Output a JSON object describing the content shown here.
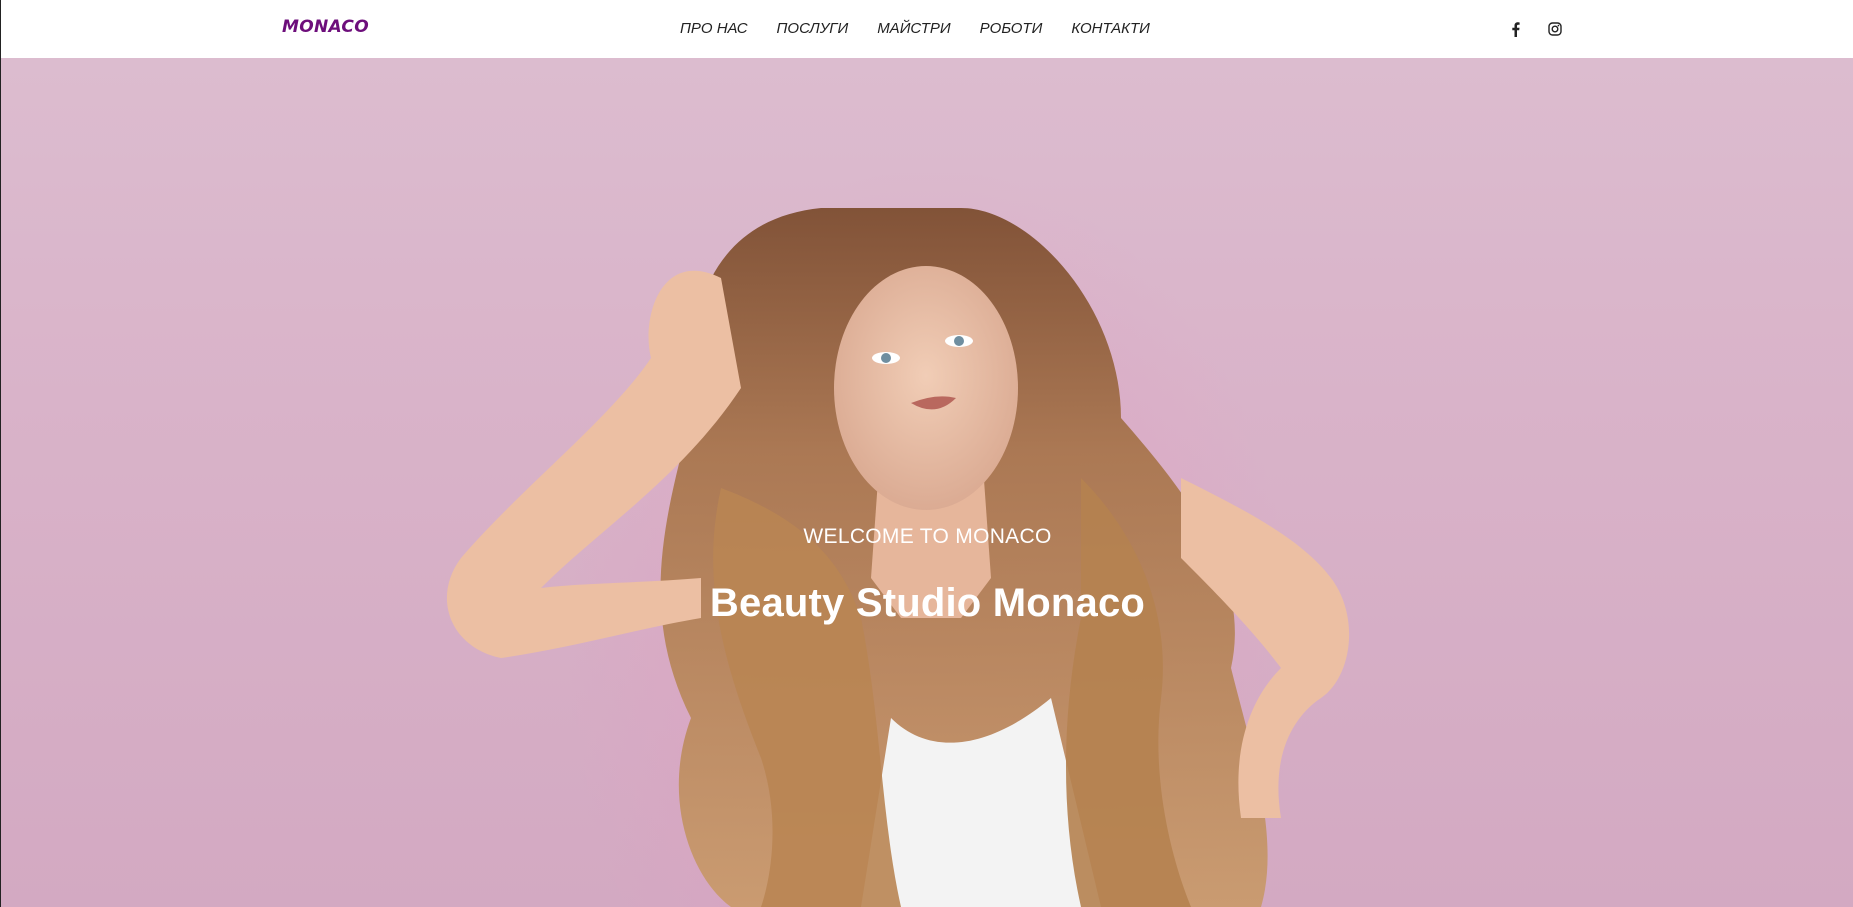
{
  "header": {
    "logo": "MONACO",
    "nav": [
      "ПРО НАС",
      "ПОСЛУГИ",
      "МАЙСТРИ",
      "РОБОТИ",
      "КОНТАКТИ"
    ],
    "social": [
      {
        "icon": "facebook-icon"
      },
      {
        "icon": "instagram-icon"
      }
    ]
  },
  "hero": {
    "subtitle": "WELCOME TO MONACO",
    "title": "Beauty Studio Monaco"
  },
  "colors": {
    "brand": "#6d0e7b",
    "nav_text": "#222222",
    "hero_bg": "#d9b3c9",
    "hero_text": "#ffffff"
  }
}
